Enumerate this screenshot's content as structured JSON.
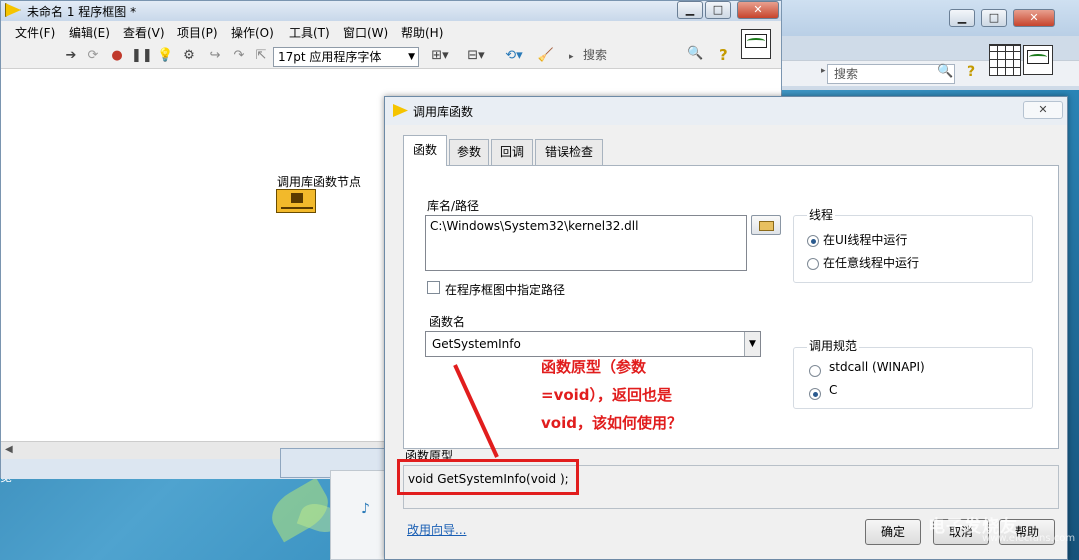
{
  "main_window": {
    "title": "未命名 1 程序框图 *",
    "menu": [
      "文件(F)",
      "编辑(E)",
      "查看(V)",
      "项目(P)",
      "操作(O)",
      "工具(T)",
      "窗口(W)",
      "帮助(H)"
    ],
    "font_select": "17pt 应用程序字体",
    "search_placeholder": "搜索",
    "help_icon": "?",
    "node_label": "调用库函数节点"
  },
  "bg_window": {
    "search_placeholder": "搜索",
    "help_icon": "?"
  },
  "dialog": {
    "title": "调用库函数",
    "tabs": [
      "函数",
      "参数",
      "回调",
      "错误检查"
    ],
    "lib_label": "库名/路径",
    "lib_path": "C:\\Windows\\System32\\kernel32.dll",
    "specify_path_label": "在程序框图中指定路径",
    "func_label": "函数名",
    "func_name": "GetSystemInfo",
    "thread_group": "线程",
    "thread_options": [
      "在UI线程中运行",
      "在任意线程中运行"
    ],
    "calling_group": "调用规范",
    "calling_options": [
      "stdcall (WINAPI)",
      "C"
    ],
    "proto_label": "函数原型",
    "prototype": "void  GetSystemInfo(void );",
    "wizard_link": "改用向导...",
    "ok_button": "确定",
    "cancel_button": "取消",
    "help_button": "帮助"
  },
  "annotation": [
    "函数原型（参数",
    "=void），返回也是",
    "void，该如何使用？"
  ],
  "desktop": {
    "text": "览",
    "watermark": "电子发烧友",
    "watermark_sub": "www.elecfans.com"
  },
  "colors": {
    "annotation": "#e11d1d",
    "title_accent": "#f5c400"
  }
}
